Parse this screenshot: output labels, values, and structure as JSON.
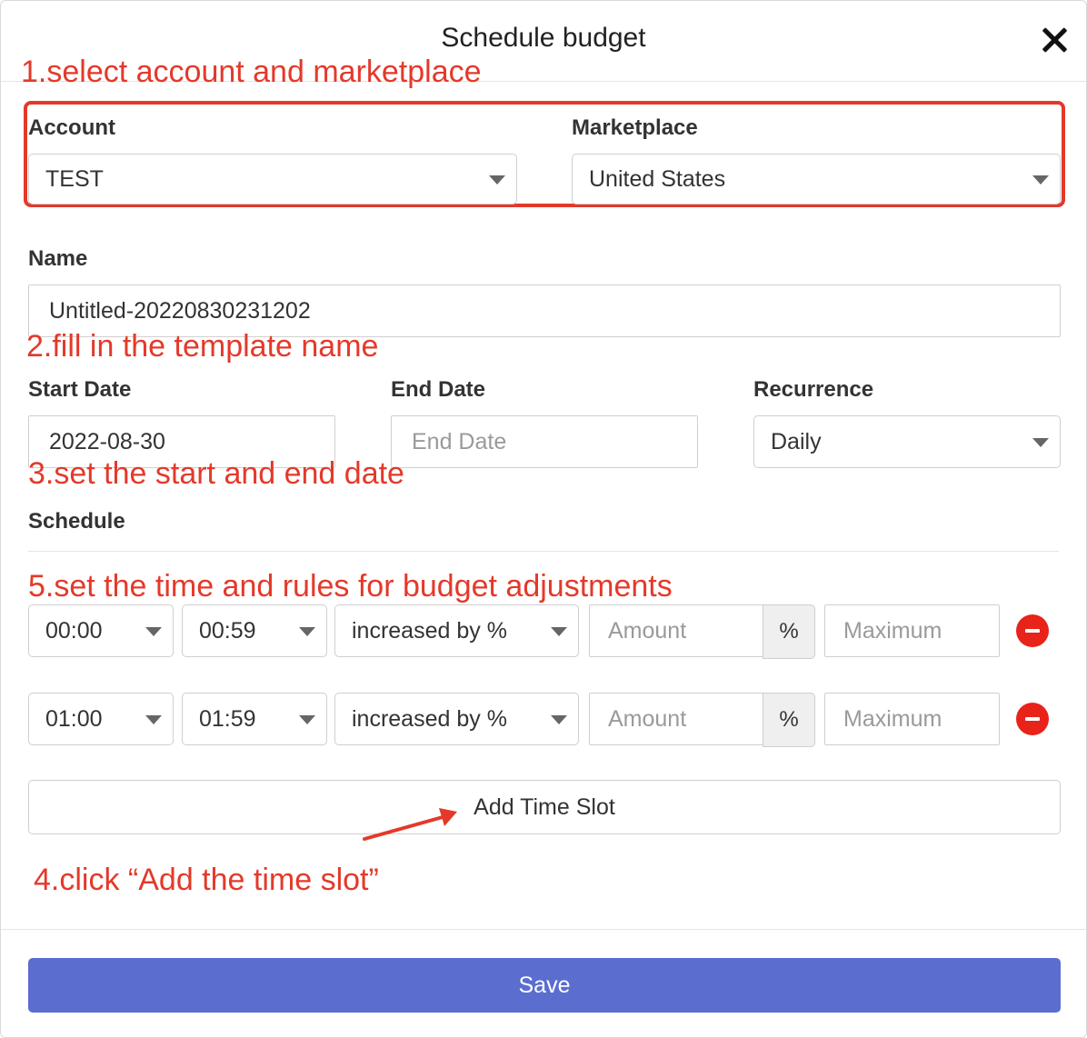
{
  "modal": {
    "title": "Schedule budget"
  },
  "annotations": {
    "step1": "1.select account and marketplace",
    "step2": "2.fill in the template name",
    "step3": "3.set the start and end date",
    "step5": "5.set the time and rules for budget adjustments",
    "step4": "4.click “Add the time slot”"
  },
  "form": {
    "account": {
      "label": "Account",
      "value": "TEST"
    },
    "marketplace": {
      "label": "Marketplace",
      "value": "United States"
    },
    "name": {
      "label": "Name",
      "value": "Untitled-20220830231202"
    },
    "start_date": {
      "label": "Start Date",
      "value": "2022-08-30"
    },
    "end_date": {
      "label": "End Date",
      "placeholder": "End Date"
    },
    "recurrence": {
      "label": "Recurrence",
      "value": "Daily"
    },
    "schedule_label": "Schedule"
  },
  "slots": [
    {
      "start": "00:00",
      "end": "00:59",
      "rule": "increased by %",
      "amount_placeholder": "Amount",
      "unit": "%",
      "max_placeholder": "Maximum"
    },
    {
      "start": "01:00",
      "end": "01:59",
      "rule": "increased by %",
      "amount_placeholder": "Amount",
      "unit": "%",
      "max_placeholder": "Maximum"
    }
  ],
  "buttons": {
    "add_time_slot": "Add Time Slot",
    "save": "Save"
  },
  "colors": {
    "annotation": "#e4392a",
    "save_button": "#5b6dcf",
    "remove": "#e8231a"
  }
}
